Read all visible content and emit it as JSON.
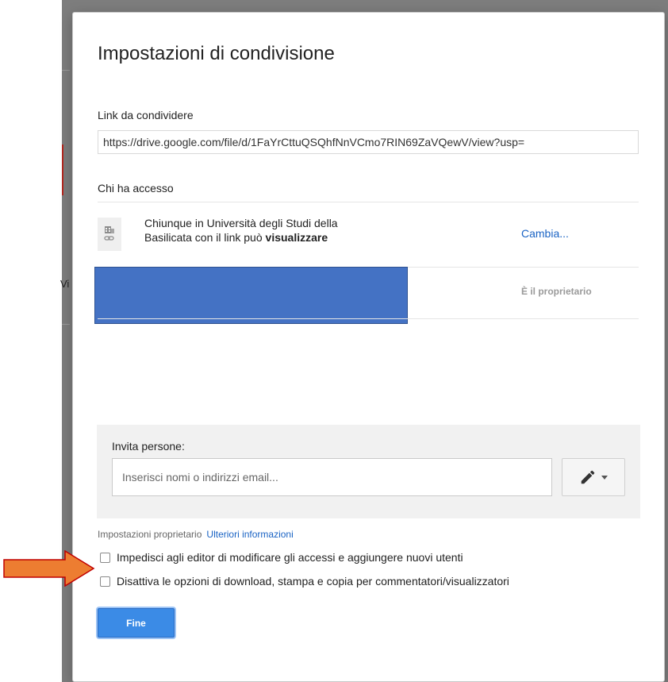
{
  "background": {
    "partial_text": "Vi"
  },
  "dialog": {
    "title": "Impostazioni di condivisione",
    "link_label": "Link da condividere",
    "link_value": "https://drive.google.com/file/d/1FaYrCttuQSQhfNnVCmo7RIN69ZaVQewV/view?usp=",
    "access_label": "Chi ha accesso",
    "access_entry": {
      "line1": "Chiunque in Università degli Studi della",
      "line2_prefix": "Basilicata con il link può ",
      "line2_bold": "visualizzare",
      "change_link": "Cambia...",
      "icon": "building-link-icon"
    },
    "owner_entry": {
      "role": "È il proprietario",
      "name_redacted": true
    },
    "invite": {
      "label": "Invita persone:",
      "placeholder": "Inserisci nomi o indirizzi email...",
      "permission_icon": "pencil-icon"
    },
    "owner_settings": {
      "label": "Impostazioni proprietario",
      "link": "Ulteriori informazioni"
    },
    "checkboxes": [
      {
        "label": "Impedisci agli editor di modificare gli accessi e aggiungere nuovi utenti",
        "checked": false
      },
      {
        "label": "Disattiva le opzioni di download, stampa e copia per commentatori/visualizzatori",
        "checked": false
      }
    ],
    "done_button": "Fine"
  },
  "annotation": {
    "arrow_color": "#ed7d31",
    "arrow_border": "#c00000"
  }
}
